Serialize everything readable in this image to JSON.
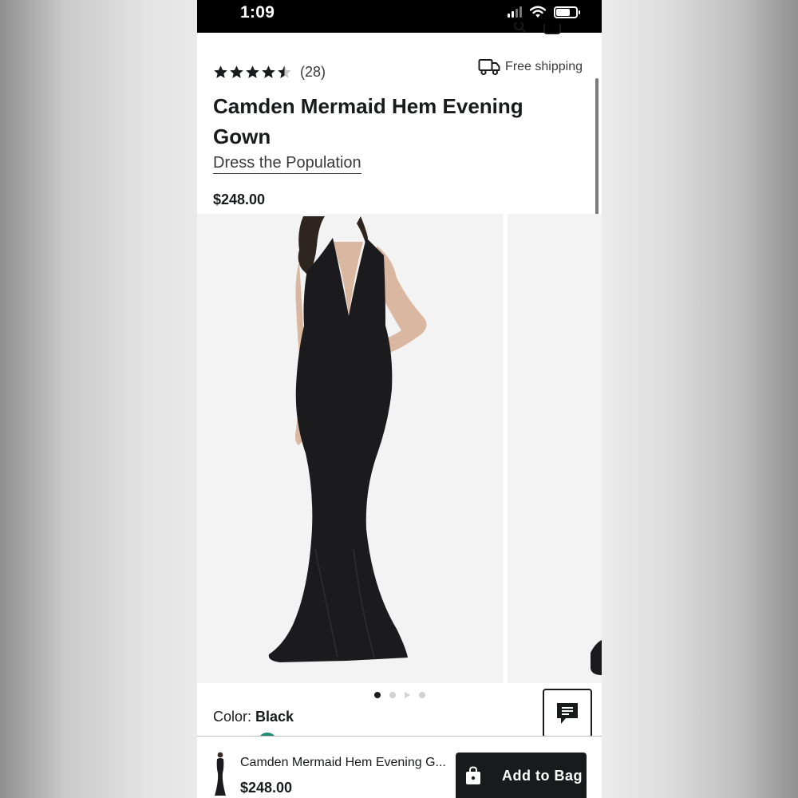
{
  "status_bar": {
    "time": "1:09",
    "icons": [
      "cellular-signal-icon",
      "wifi-icon",
      "battery-icon"
    ]
  },
  "product": {
    "rating": 4.5,
    "review_count": "(28)",
    "shipping_label": "Free shipping",
    "title": "Camden Mermaid Hem Evening Gown",
    "brand": "Dress the Population",
    "price": "$248.00",
    "color_label": "Color:",
    "color_value": "Black"
  },
  "gallery": {
    "current_slide": 1,
    "slide_count": 4,
    "pager": [
      "dot",
      "dot",
      "play",
      "dot"
    ]
  },
  "sticky_bar": {
    "title": "Camden Mermaid Hem Evening G...",
    "price": "$248.00",
    "add_to_bag_label": "Add to Bag"
  },
  "colors": {
    "text": "#191a1b",
    "secondary_text": "#393939",
    "image_background": "#f3f3f3",
    "swatch_peek": "#1f8a70"
  }
}
